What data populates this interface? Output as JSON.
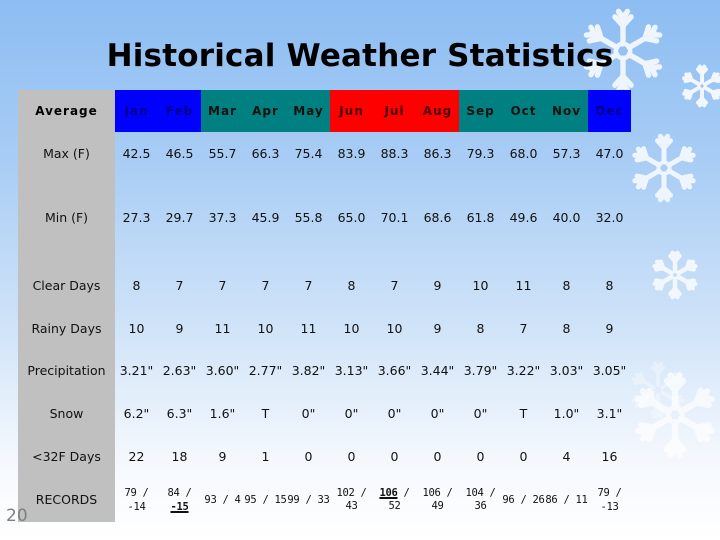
{
  "title": "Historical Weather Statistics",
  "page_number": "20",
  "header_label": "Average",
  "months": [
    {
      "label": "Jan",
      "season": "winter"
    },
    {
      "label": "Feb",
      "season": "winter"
    },
    {
      "label": "Mar",
      "season": "spring"
    },
    {
      "label": "Apr",
      "season": "spring"
    },
    {
      "label": "May",
      "season": "spring"
    },
    {
      "label": "Jun",
      "season": "summer"
    },
    {
      "label": "Jul",
      "season": "summer"
    },
    {
      "label": "Aug",
      "season": "summer"
    },
    {
      "label": "Sep",
      "season": "fall"
    },
    {
      "label": "Oct",
      "season": "fall"
    },
    {
      "label": "Nov",
      "season": "fall"
    },
    {
      "label": "Dec",
      "season": "winter"
    }
  ],
  "season_colors": {
    "winter": "#0000ff",
    "spring": "#008080",
    "summer": "#ff0000",
    "fall": "#008080",
    "label_column": "#c0c0c0"
  },
  "rows": [
    {
      "label": "Max (F)",
      "values": [
        "42.5",
        "46.5",
        "55.7",
        "66.3",
        "75.4",
        "83.9",
        "88.3",
        "86.3",
        "79.3",
        "68.0",
        "57.3",
        "47.0"
      ]
    },
    {
      "label": "Min (F)",
      "values": [
        "27.3",
        "29.7",
        "37.3",
        "45.9",
        "55.8",
        "65.0",
        "70.1",
        "68.6",
        "61.8",
        "49.6",
        "40.0",
        "32.0"
      ]
    },
    {
      "label": "Clear Days",
      "values": [
        "8",
        "7",
        "7",
        "7",
        "7",
        "8",
        "7",
        "9",
        "10",
        "11",
        "8",
        "8"
      ]
    },
    {
      "label": "Rainy Days",
      "values": [
        "10",
        "9",
        "11",
        "10",
        "11",
        "10",
        "10",
        "9",
        "8",
        "7",
        "8",
        "9"
      ]
    },
    {
      "label": "Precipitation",
      "values": [
        "3.21\"",
        "2.63\"",
        "3.60\"",
        "2.77\"",
        "3.82\"",
        "3.13\"",
        "3.66\"",
        "3.44\"",
        "3.79\"",
        "3.22\"",
        "3.03\"",
        "3.05\""
      ]
    },
    {
      "label": "Snow",
      "values": [
        "6.2\"",
        "6.3\"",
        "1.6\"",
        "T",
        "0\"",
        "0\"",
        "0\"",
        "0\"",
        "0\"",
        "T",
        "1.0\"",
        "3.1\""
      ]
    },
    {
      "label": "<32F Days",
      "values": [
        "22",
        "18",
        "9",
        "1",
        "0",
        "0",
        "0",
        "0",
        "0",
        "0",
        "4",
        "16"
      ]
    }
  ],
  "records": {
    "label": "RECORDS",
    "values": [
      {
        "high": "79",
        "low": "-14"
      },
      {
        "high": "84",
        "low": "-15",
        "low_emphasized": true
      },
      {
        "high": "93",
        "low": "4"
      },
      {
        "high": "95",
        "low": "15"
      },
      {
        "high": "99",
        "low": "33"
      },
      {
        "high": "102",
        "low": "43"
      },
      {
        "high": "106",
        "low": "52",
        "high_emphasized": true
      },
      {
        "high": "106",
        "low": "49"
      },
      {
        "high": "104",
        "low": "36"
      },
      {
        "high": "96",
        "low": "26"
      },
      {
        "high": "86",
        "low": "11"
      },
      {
        "high": "79",
        "low": "-13"
      }
    ]
  }
}
